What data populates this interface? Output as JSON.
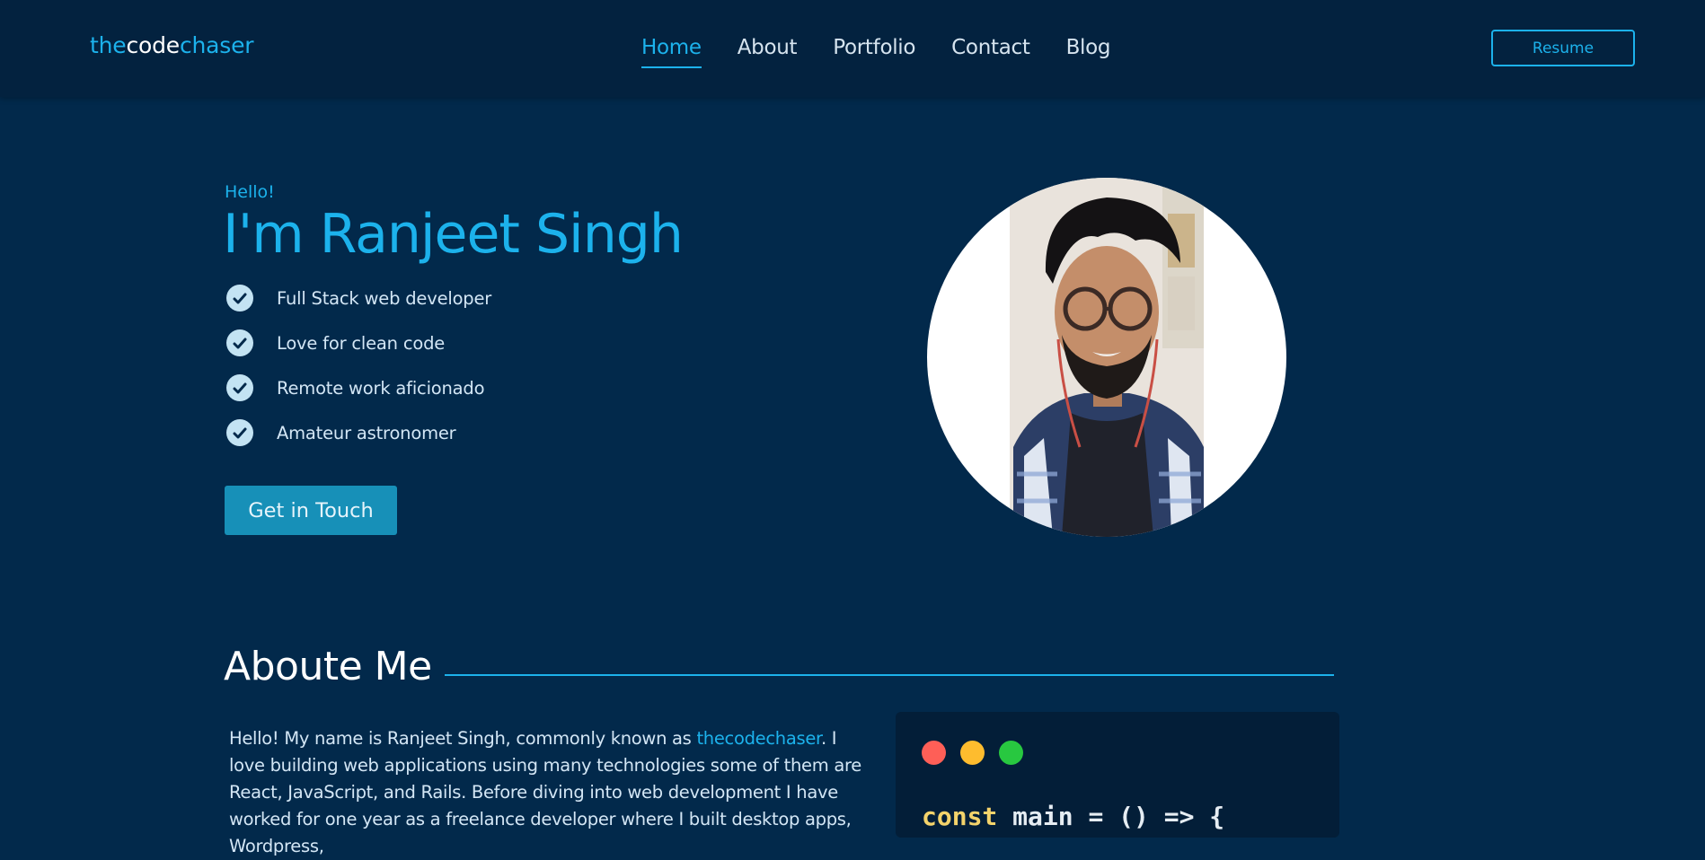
{
  "logo": {
    "part1": "the",
    "part2": "code",
    "part3": "chaser"
  },
  "nav": {
    "items": [
      {
        "label": "Home",
        "active": true
      },
      {
        "label": "About",
        "active": false
      },
      {
        "label": "Portfolio",
        "active": false
      },
      {
        "label": "Contact",
        "active": false
      },
      {
        "label": "Blog",
        "active": false
      }
    ],
    "resume_label": "Resume"
  },
  "hero": {
    "greeting": "Hello!",
    "name": "I'm Ranjeet Singh",
    "features": [
      "Full Stack web developer",
      "Love for clean code",
      "Remote work aficionado",
      "Amateur astronomer"
    ],
    "cta_label": "Get in Touch"
  },
  "about": {
    "title": "Aboute Me",
    "text_before": "Hello! My name is Ranjeet Singh, commonly known as ",
    "link_text": "thecodechaser",
    "text_after": ". I love building web applications using many technologies some of them are React, JavaScript, and Rails. Before diving into web development I have worked for one year as a freelance developer where I built desktop apps, Wordpress,"
  },
  "code_window": {
    "keyword": "const",
    "rest": " main = () => {"
  },
  "colors": {
    "background": "#02294b",
    "navbar": "#03223f",
    "accent": "#1cb2ec",
    "button": "#1790b8",
    "dot_red": "#fe5f57",
    "dot_yellow": "#febc2e",
    "dot_green": "#28c840"
  }
}
